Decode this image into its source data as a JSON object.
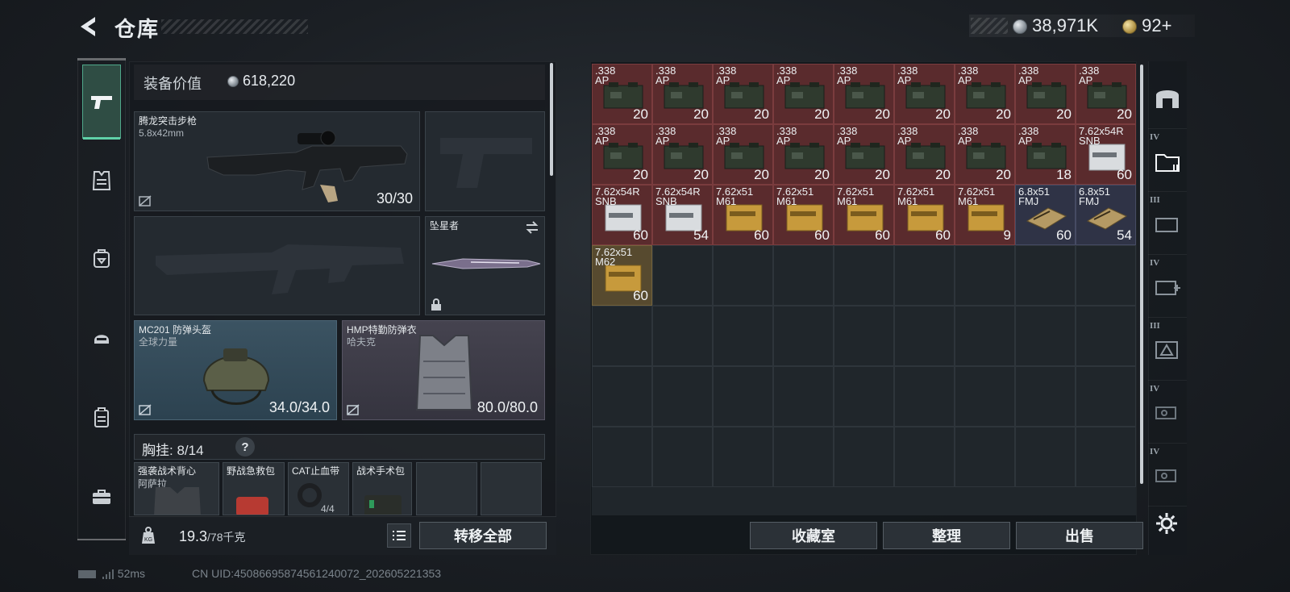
{
  "header": {
    "title": "仓库",
    "money": "38,971K",
    "tickets": "92",
    "tickets_suffix": "+"
  },
  "equipment": {
    "value_label": "装备价值",
    "value": "618,220",
    "primary_weapon": {
      "name": "腾龙突击步枪",
      "caliber": "5.8x42mm",
      "ammo": "30/30"
    },
    "melee": {
      "name": "坠星者"
    },
    "helmet": {
      "name": "MC201 防弹头盔",
      "brand": "全球力量",
      "durability": "34.0/34.0"
    },
    "armor": {
      "name": "HMP特勤防弹衣",
      "brand": "哈夫克",
      "durability": "80.0/80.0"
    },
    "rig": {
      "label": "胸挂:",
      "count": "8/14",
      "help": "?",
      "items": [
        {
          "name": "强袭战术背心",
          "sub": "阿萨拉"
        },
        {
          "name": "野战急救包",
          "sub": ""
        },
        {
          "name": "CAT止血带",
          "sub": "4/4"
        },
        {
          "name": "战术手术包",
          "sub": ""
        },
        {
          "name": "",
          "sub": ""
        },
        {
          "name": "",
          "sub": ""
        }
      ]
    },
    "weight": "19.3",
    "weight_max": "/78千克",
    "transfer_all": "转移全部"
  },
  "stash": {
    "items": [
      {
        "name": ".338 AP",
        "count": "20",
        "type": "ap"
      },
      {
        "name": ".338 AP",
        "count": "20",
        "type": "ap"
      },
      {
        "name": ".338 AP",
        "count": "20",
        "type": "ap"
      },
      {
        "name": ".338 AP",
        "count": "20",
        "type": "ap"
      },
      {
        "name": ".338 AP",
        "count": "20",
        "type": "ap"
      },
      {
        "name": ".338 AP",
        "count": "20",
        "type": "ap"
      },
      {
        "name": ".338 AP",
        "count": "20",
        "type": "ap"
      },
      {
        "name": ".338 AP",
        "count": "20",
        "type": "ap"
      },
      {
        "name": ".338 AP",
        "count": "20",
        "type": "ap"
      },
      {
        "name": ".338 AP",
        "count": "20",
        "type": "ap"
      },
      {
        "name": ".338 AP",
        "count": "20",
        "type": "ap"
      },
      {
        "name": ".338 AP",
        "count": "20",
        "type": "ap"
      },
      {
        "name": ".338 AP",
        "count": "20",
        "type": "ap"
      },
      {
        "name": ".338 AP",
        "count": "20",
        "type": "ap"
      },
      {
        "name": ".338 AP",
        "count": "20",
        "type": "ap"
      },
      {
        "name": ".338 AP",
        "count": "20",
        "type": "ap"
      },
      {
        "name": ".338 AP",
        "count": "18",
        "type": "ap"
      },
      {
        "name": "7.62x54R SNB",
        "count": "60",
        "type": "snb"
      },
      {
        "name": "7.62x54R SNB",
        "count": "60",
        "type": "snb"
      },
      {
        "name": "7.62x54R SNB",
        "count": "54",
        "type": "snb"
      },
      {
        "name": "7.62x51 M61",
        "count": "60",
        "type": "m61"
      },
      {
        "name": "7.62x51 M61",
        "count": "60",
        "type": "m61"
      },
      {
        "name": "7.62x51 M61",
        "count": "60",
        "type": "m61"
      },
      {
        "name": "7.62x51 M61",
        "count": "60",
        "type": "m61"
      },
      {
        "name": "7.62x51 M61",
        "count": "9",
        "type": "m61"
      },
      {
        "name": "6.8x51 FMJ",
        "count": "60",
        "type": "fmj"
      },
      {
        "name": "6.8x51 FMJ",
        "count": "54",
        "type": "fmj"
      },
      {
        "name": "7.62x51 M62",
        "count": "60",
        "type": "m62"
      }
    ],
    "collection_room": "收藏室",
    "organize": "整理",
    "sell": "出售"
  },
  "right_rail": {
    "tiers": [
      "",
      "IV",
      "III",
      "IV",
      "III",
      "IV",
      "IV"
    ]
  },
  "status": {
    "ping": "52ms",
    "uid": "CN UID:45086695874561240072_202605221353"
  },
  "colors": {
    "accent": "#5fd1a8",
    "rare_red": "#5a2b2d",
    "epic_blue": "#2f3346",
    "panel": "#242a30"
  }
}
